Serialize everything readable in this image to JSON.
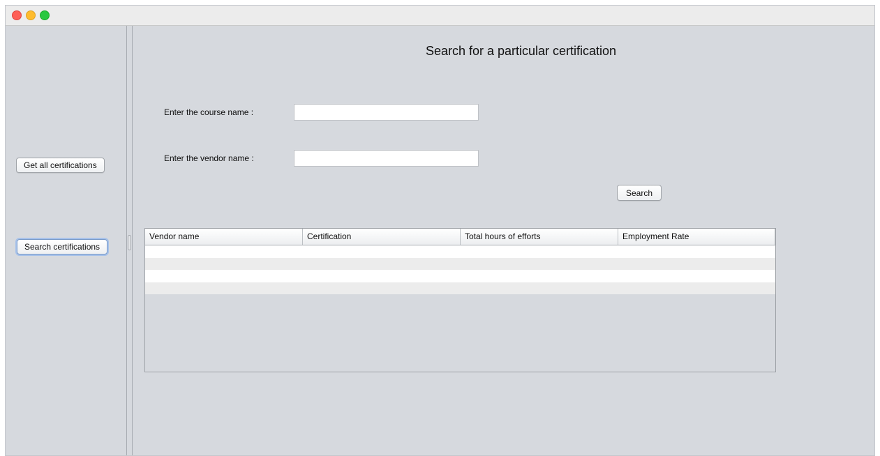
{
  "window": {
    "title": ""
  },
  "sidebar": {
    "get_all_label": "Get all certifications",
    "search_label": "Search certifications"
  },
  "main": {
    "title": "Search for a particular certification",
    "course_label": "Enter the course name :",
    "course_value": "",
    "vendor_label": "Enter the vendor name :",
    "vendor_value": "",
    "search_button_label": "Search"
  },
  "table": {
    "columns": [
      "Vendor name",
      "Certification",
      "Total hours of efforts",
      "Employment Rate"
    ],
    "rows": []
  },
  "colors": {
    "background": "#d6d9de",
    "close": "#fe5f57",
    "minimize": "#febc2e",
    "maximize": "#28c840"
  }
}
